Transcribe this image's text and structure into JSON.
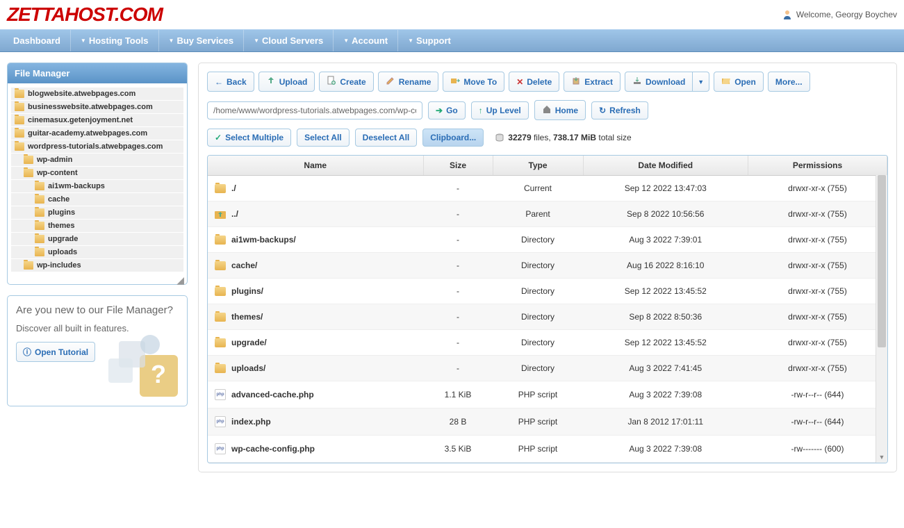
{
  "logo": "ZETTAHOST.COM",
  "welcome": "Welcome, Georgy Boychev",
  "nav": [
    {
      "label": "Dashboard",
      "dropdown": false
    },
    {
      "label": "Hosting Tools",
      "dropdown": true
    },
    {
      "label": "Buy Services",
      "dropdown": true
    },
    {
      "label": "Cloud Servers",
      "dropdown": true
    },
    {
      "label": "Account",
      "dropdown": true
    },
    {
      "label": "Support",
      "dropdown": true
    }
  ],
  "sidebar": {
    "title": "File Manager",
    "tree": [
      {
        "label": "blogwebsite.atwebpages.com",
        "level": 0
      },
      {
        "label": "businesswebsite.atwebpages.com",
        "level": 0
      },
      {
        "label": "cinemasux.getenjoyment.net",
        "level": 0
      },
      {
        "label": "guitar-academy.atwebpages.com",
        "level": 0
      },
      {
        "label": "wordpress-tutorials.atwebpages.com",
        "level": 0
      },
      {
        "label": "wp-admin",
        "level": 1
      },
      {
        "label": "wp-content",
        "level": 1
      },
      {
        "label": "ai1wm-backups",
        "level": 2
      },
      {
        "label": "cache",
        "level": 2
      },
      {
        "label": "plugins",
        "level": 2
      },
      {
        "label": "themes",
        "level": 2
      },
      {
        "label": "upgrade",
        "level": 2
      },
      {
        "label": "uploads",
        "level": 2
      },
      {
        "label": "wp-includes",
        "level": 1
      }
    ]
  },
  "tutorial": {
    "title": "Are you new to our File Manager?",
    "sub": "Discover all built in features.",
    "button": "Open Tutorial"
  },
  "toolbar": {
    "back": "Back",
    "upload": "Upload",
    "create": "Create",
    "rename": "Rename",
    "moveto": "Move To",
    "delete": "Delete",
    "extract": "Extract",
    "download": "Download",
    "open": "Open",
    "more": "More..."
  },
  "path": {
    "value": "/home/www/wordpress-tutorials.atwebpages.com/wp-content",
    "go": "Go",
    "uplevel": "Up Level",
    "home": "Home",
    "refresh": "Refresh"
  },
  "selectbar": {
    "selectmultiple": "Select Multiple",
    "selectall": "Select All",
    "deselectall": "Deselect All",
    "clipboard": "Clipboard..."
  },
  "stats": {
    "count": "32279",
    "files_label": " files, ",
    "size": "738.17 MiB",
    "total_label": " total size"
  },
  "table": {
    "headers": {
      "name": "Name",
      "size": "Size",
      "type": "Type",
      "modified": "Date Modified",
      "permissions": "Permissions"
    },
    "rows": [
      {
        "icon": "folder",
        "name": "./",
        "size": "-",
        "type": "Current",
        "modified": "Sep 12 2022 13:47:03",
        "perm": "drwxr-xr-x (755)"
      },
      {
        "icon": "up",
        "name": "../",
        "size": "-",
        "type": "Parent",
        "modified": "Sep 8 2022 10:56:56",
        "perm": "drwxr-xr-x (755)"
      },
      {
        "icon": "folder",
        "name": "ai1wm-backups/",
        "size": "-",
        "type": "Directory",
        "modified": "Aug 3 2022 7:39:01",
        "perm": "drwxr-xr-x (755)"
      },
      {
        "icon": "folder",
        "name": "cache/",
        "size": "-",
        "type": "Directory",
        "modified": "Aug 16 2022 8:16:10",
        "perm": "drwxr-xr-x (755)"
      },
      {
        "icon": "folder",
        "name": "plugins/",
        "size": "-",
        "type": "Directory",
        "modified": "Sep 12 2022 13:45:52",
        "perm": "drwxr-xr-x (755)"
      },
      {
        "icon": "folder",
        "name": "themes/",
        "size": "-",
        "type": "Directory",
        "modified": "Sep 8 2022 8:50:36",
        "perm": "drwxr-xr-x (755)"
      },
      {
        "icon": "folder",
        "name": "upgrade/",
        "size": "-",
        "type": "Directory",
        "modified": "Sep 12 2022 13:45:52",
        "perm": "drwxr-xr-x (755)"
      },
      {
        "icon": "folder",
        "name": "uploads/",
        "size": "-",
        "type": "Directory",
        "modified": "Aug 3 2022 7:41:45",
        "perm": "drwxr-xr-x (755)"
      },
      {
        "icon": "php",
        "name": "advanced-cache.php",
        "size": "1.1 KiB",
        "type": "PHP script",
        "modified": "Aug 3 2022 7:39:08",
        "perm": "-rw-r--r-- (644)"
      },
      {
        "icon": "php",
        "name": "index.php",
        "size": "28 B",
        "type": "PHP script",
        "modified": "Jan 8 2012 17:01:11",
        "perm": "-rw-r--r-- (644)"
      },
      {
        "icon": "php",
        "name": "wp-cache-config.php",
        "size": "3.5 KiB",
        "type": "PHP script",
        "modified": "Aug 3 2022 7:39:08",
        "perm": "-rw------- (600)"
      }
    ]
  }
}
